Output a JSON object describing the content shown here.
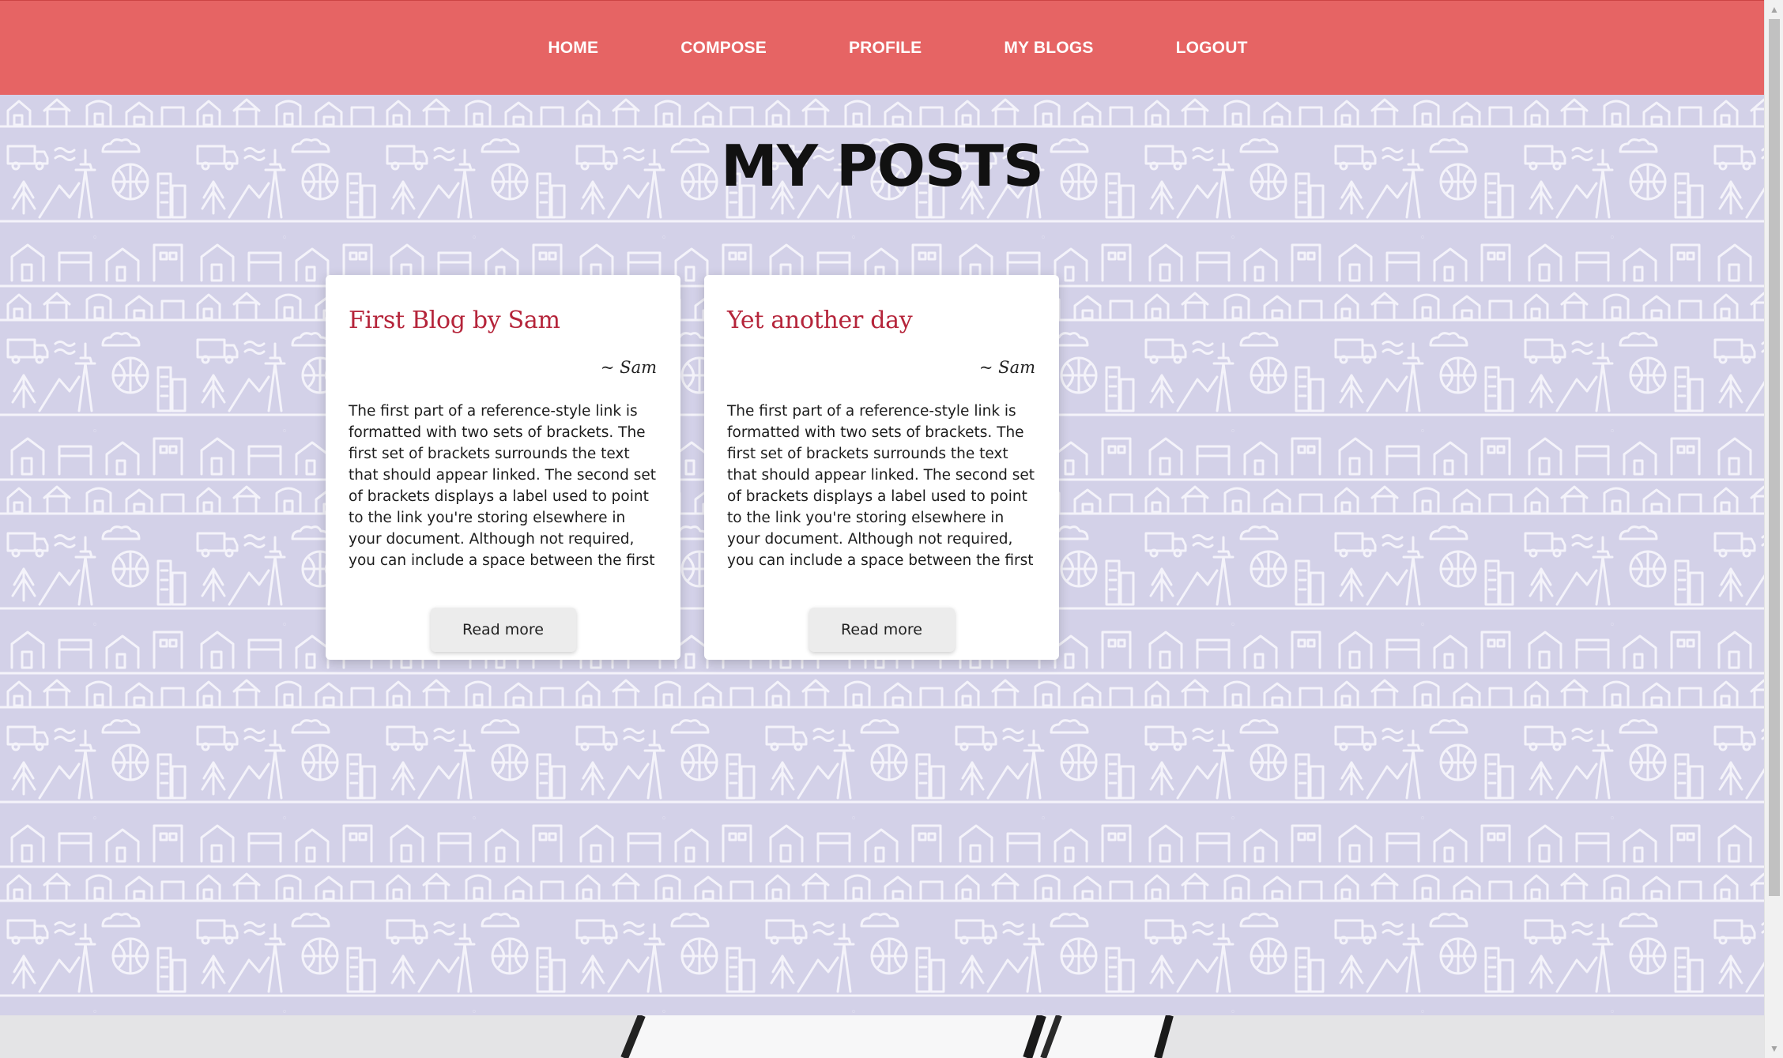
{
  "nav": {
    "items": [
      {
        "label": "HOME"
      },
      {
        "label": "COMPOSE"
      },
      {
        "label": "PROFILE"
      },
      {
        "label": "MY BLOGS"
      },
      {
        "label": "LOGOUT"
      }
    ]
  },
  "main": {
    "title": "MY POSTS",
    "posts": [
      {
        "title": "First Blog by Sam",
        "author": "~ Sam",
        "body": "The first part of a reference-style link is formatted with two sets of brackets. The first set of brackets surrounds the text that should appear linked. The second set of brackets displays a label used to point to the link you're storing elsewhere in your document. Although not required, you can include a space between the first and second set of brackets. The label in the",
        "button": "Read more"
      },
      {
        "title": "Yet another day",
        "author": "~ Sam",
        "body": "The first part of a reference-style link is formatted with two sets of brackets. The first set of brackets surrounds the text that should appear linked. The second set of brackets displays a label used to point to the link you're storing elsewhere in your document. Although not required, you can include a space between the first and second set of brackets. The label in the",
        "button": "Read more"
      }
    ]
  },
  "background": {
    "watermark": "Moovd"
  },
  "colors": {
    "navbar": "#e66464",
    "pattern_bg": "#d3d1e8",
    "card_title": "#b5243a"
  }
}
